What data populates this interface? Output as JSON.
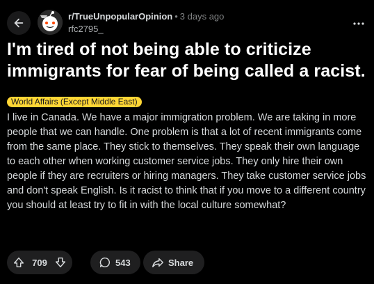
{
  "header": {
    "subreddit": "r/TrueUnpopularOpinion",
    "separator": "•",
    "time": "3 days ago",
    "username": "rfc2795_"
  },
  "post": {
    "title": "I'm tired of not being able to criticize immigrants for fear of being called a racist.",
    "flair": "World Affairs (Except Middle East)",
    "body": "I live in Canada. We have a major immigration problem. We are taking in more people that we can handle. One problem is that a lot of recent immigrants come from the same place. They stick to themselves. They speak their own language to each other when working customer service jobs. They only hire their own people if they are recruiters or hiring managers. They take customer service jobs and don't speak English. Is it racist to think that if you move to a different country you should at least try to fit in with the local culture somewhat?"
  },
  "actions": {
    "votes": "709",
    "comments": "543",
    "share_label": "Share"
  },
  "colors": {
    "background": "#000000",
    "flair_bg": "#ffd635",
    "pill_bg": "#1f1f20",
    "text": "#d7dadc"
  },
  "icons": {
    "back": "arrow-left-icon",
    "more": "more-horizontal-icon",
    "upvote": "upvote-arrow-icon",
    "downvote": "downvote-arrow-icon",
    "comment": "comment-bubble-icon",
    "share": "share-arrow-icon"
  }
}
